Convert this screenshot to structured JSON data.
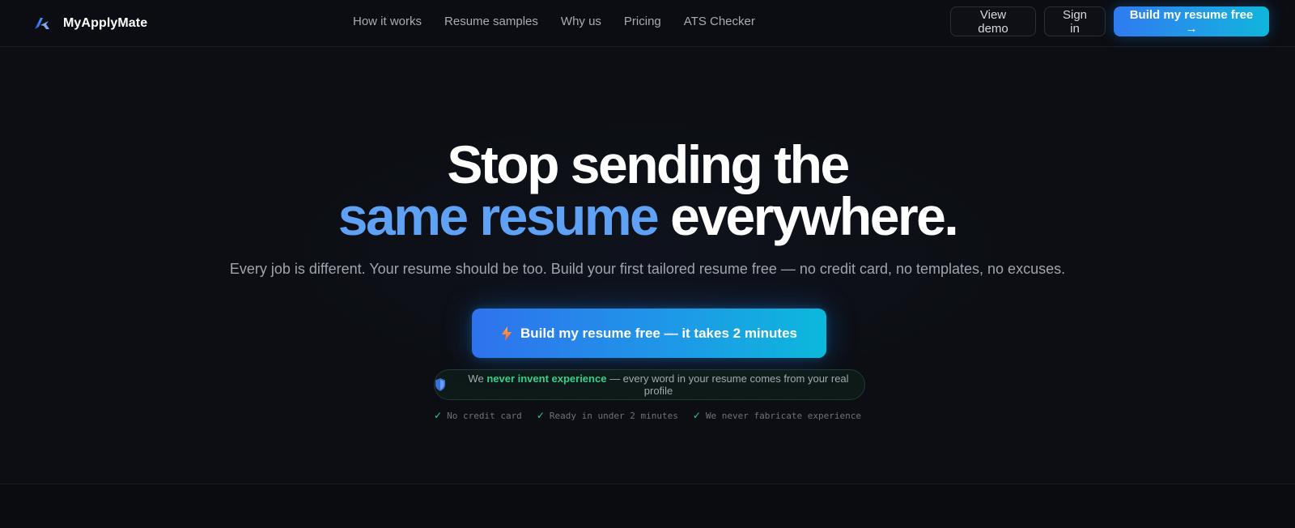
{
  "brand": {
    "name": "MyApplyMate",
    "logo_icon": "logo-icon"
  },
  "nav": {
    "links": [
      "How it works",
      "Resume samples",
      "Why us",
      "Pricing",
      "ATS Checker"
    ],
    "view_demo": "View demo",
    "sign_in": "Sign in",
    "build_free": "Build my resume free →"
  },
  "hero": {
    "line1": "Stop sending the",
    "line2_accent": "same resume",
    "line2_rest": " everywhere.",
    "subtitle": "Every job is different. Your resume should be too. Build your first tailored resume free — no credit card, no templates, no excuses.",
    "cta_label": "Build my resume free — it takes 2 minutes",
    "cta_icon": "lightning-icon",
    "badge": {
      "prefix": "We ",
      "highlight": "never invent experience",
      "suffix": " — every word in your resume comes from your real profile",
      "icon": "shield-icon"
    },
    "checks": [
      "No credit card",
      "Ready in under 2 minutes",
      "We never fabricate experience"
    ]
  },
  "colors": {
    "accent_blue": "#5ea1f5",
    "badge_green": "#35d08a",
    "check_green": "#2fcf86",
    "background": "#0c0e13"
  }
}
